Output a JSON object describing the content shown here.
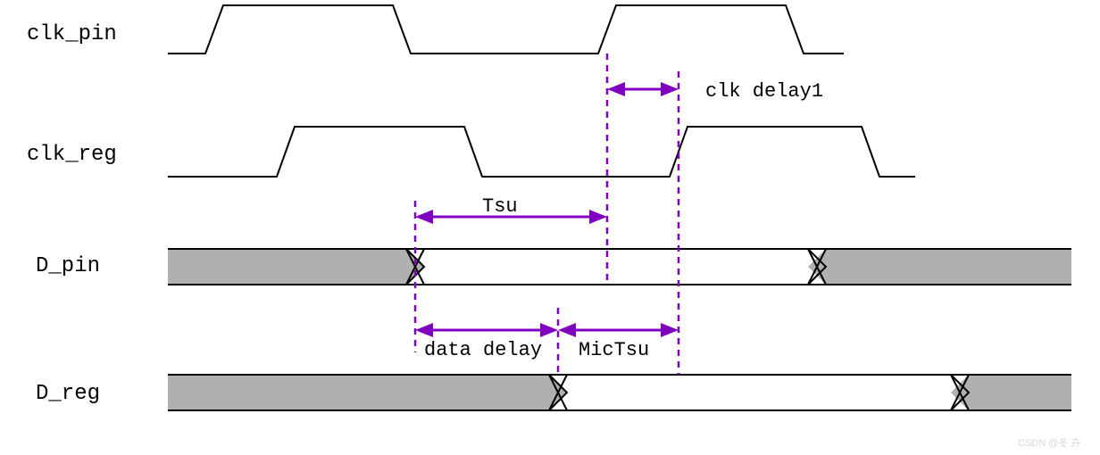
{
  "signals": {
    "clk_pin": "clk_pin",
    "clk_reg": "clk_reg",
    "d_pin": "D_pin",
    "d_reg": "D_reg"
  },
  "annotations": {
    "clk_delay1": "clk delay1",
    "tsu": "Tsu",
    "data_delay": "data delay",
    "mic_tsu": "MicTsu"
  },
  "watermark": "CSDN @冬 卉"
}
